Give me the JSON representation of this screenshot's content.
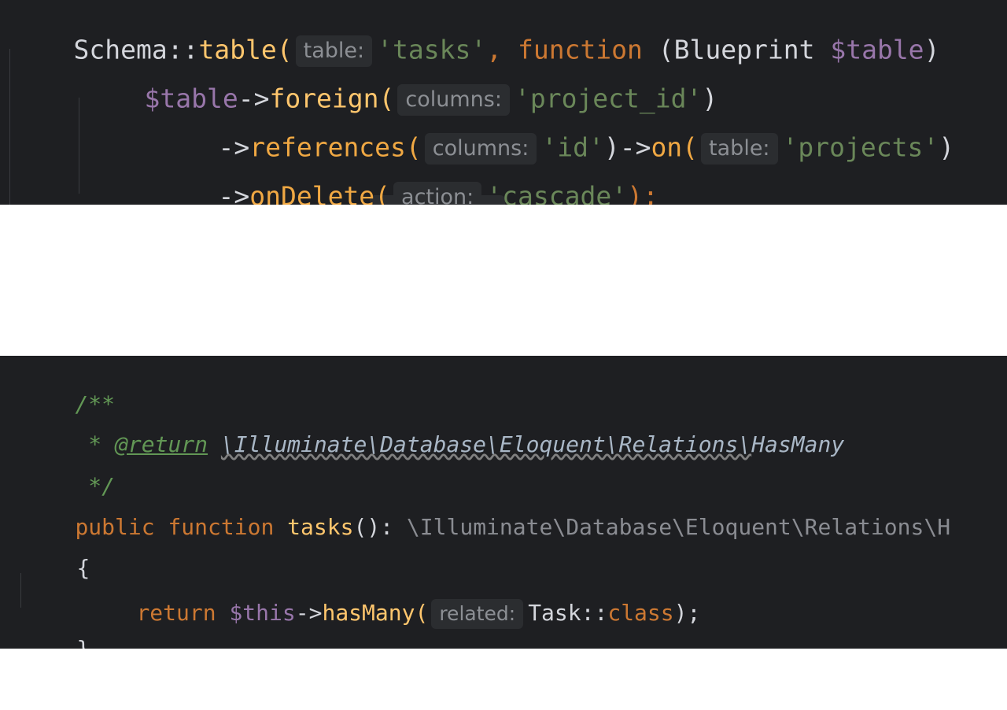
{
  "top_snippet": {
    "line1": {
      "t1": "Schema::",
      "t2": "table(",
      "hint": "table:",
      "t3": "'tasks'",
      "t4": ", ",
      "t5": "function",
      "t6": " (Blueprint ",
      "t7": "$table",
      "t8": ")"
    },
    "line2": {
      "t1": "$table",
      "t2": "->",
      "t3": "foreign(",
      "hint": "columns:",
      "t4": "'project_id'",
      "t5": ")"
    },
    "line3": {
      "t1": "->",
      "t2": "references(",
      "hint1": "columns:",
      "t3": "'id'",
      "t4": ")->",
      "t5": "on(",
      "hint2": "table:",
      "t6": "'projects'",
      "t7": ")"
    },
    "line4": {
      "t1": "->",
      "t2": "onDelete(",
      "hint": "action:",
      "t3": "'cascade'",
      "t4": ");"
    }
  },
  "bottom_snippet": {
    "doc_open": "/**",
    "doc_return": {
      "star": " * ",
      "tag": "@return",
      "space": " ",
      "type": "\\Illuminate\\Database\\Eloquent\\Relations\\",
      "type_end": "HasMany"
    },
    "doc_close": " */",
    "signature": {
      "t1": "public",
      "t2": " ",
      "t3": "function",
      "t4": " ",
      "t5": "tasks",
      "t6": "(): ",
      "t7": "\\Illuminate\\Database\\Eloquent\\Relations\\H"
    },
    "brace_open": "{",
    "return_line": {
      "t1": "return",
      "t2": " ",
      "t3": "$this",
      "t4": "->",
      "t5": "hasMany(",
      "hint": "related:",
      "t6": "Task::",
      "t7": "class",
      "t8": ");"
    },
    "brace_close": "}"
  }
}
